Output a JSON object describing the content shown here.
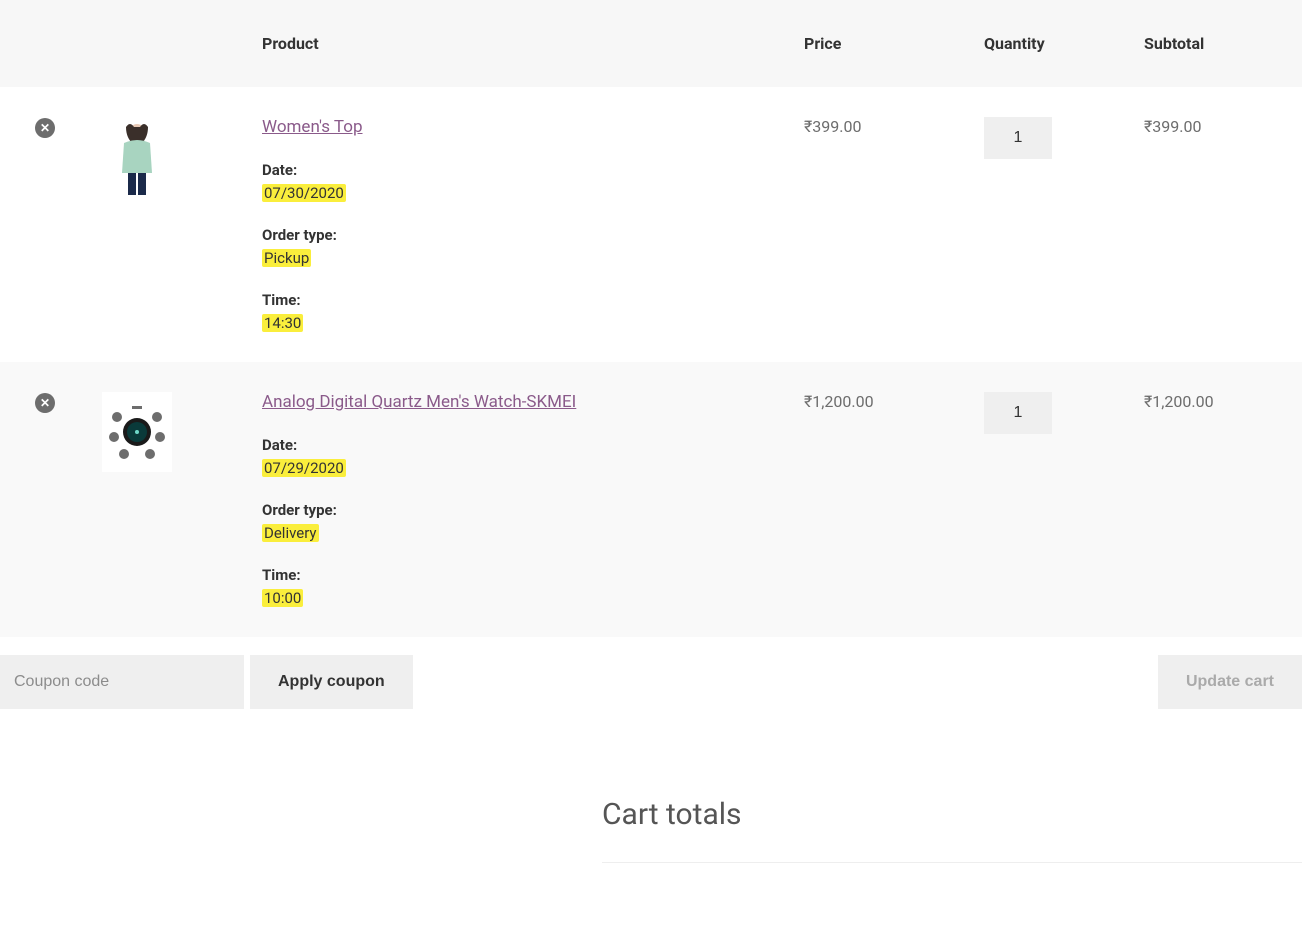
{
  "headers": {
    "product": "Product",
    "price": "Price",
    "quantity": "Quantity",
    "subtotal": "Subtotal"
  },
  "items": [
    {
      "name": "Women's Top",
      "price": "₹399.00",
      "qty": "1",
      "subtotal": "₹399.00",
      "date_label": "Date:",
      "date": "07/30/2020",
      "order_type_label": "Order type:",
      "order_type": "Pickup",
      "time_label": "Time:",
      "time": "14:30"
    },
    {
      "name": "Analog Digital Quartz Men's Watch-SKMEI",
      "price": "₹1,200.00",
      "qty": "1",
      "subtotal": "₹1,200.00",
      "date_label": "Date:",
      "date": "07/29/2020",
      "order_type_label": "Order type:",
      "order_type": "Delivery",
      "time_label": "Time:",
      "time": "10:00"
    }
  ],
  "coupon": {
    "placeholder": "Coupon code",
    "apply_label": "Apply coupon"
  },
  "update_label": "Update cart",
  "totals_title": "Cart totals"
}
